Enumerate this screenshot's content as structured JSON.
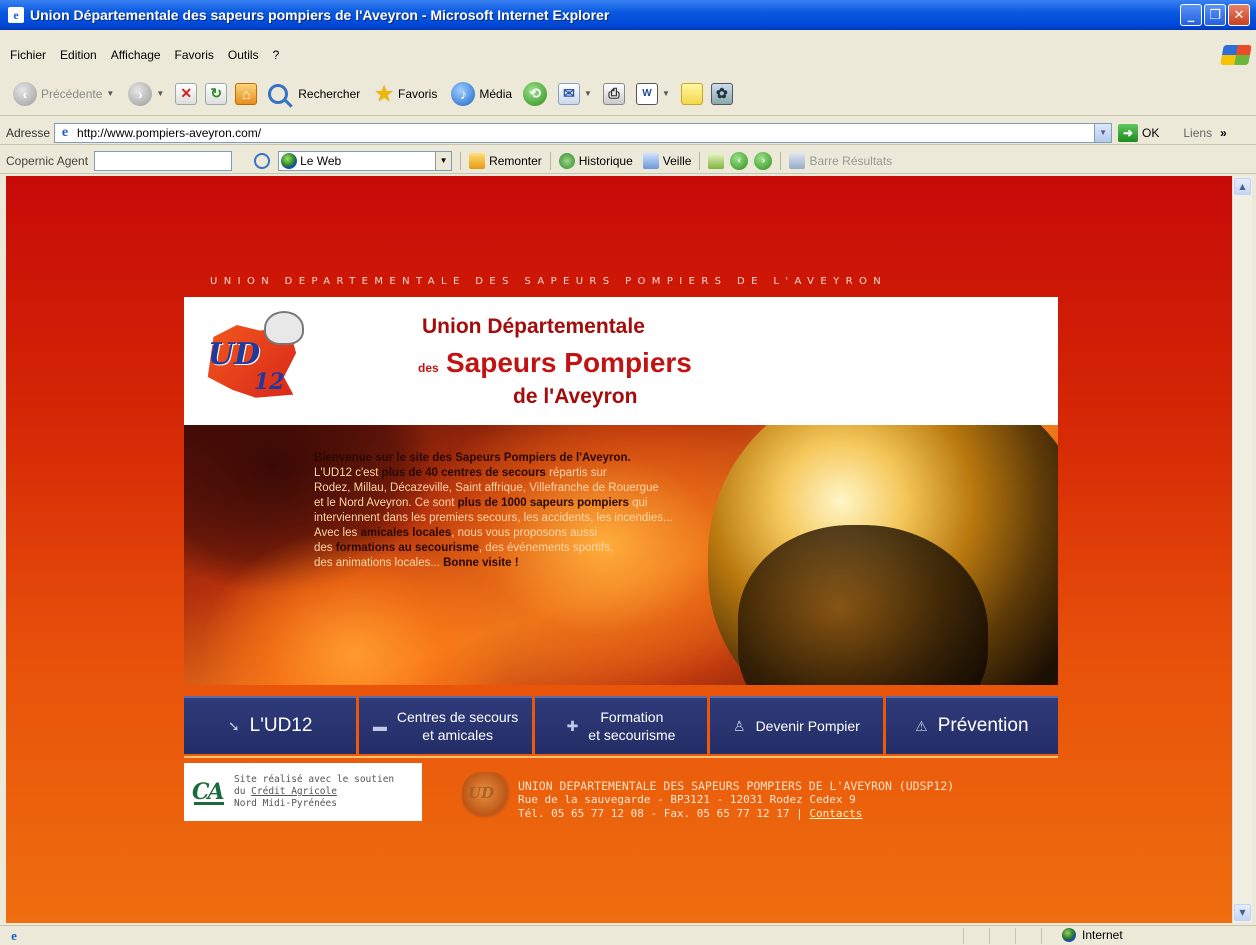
{
  "window": {
    "title": "Union Départementale des sapeurs pompiers de l'Aveyron - Microsoft Internet Explorer",
    "buttons": [
      "minimize",
      "maximize",
      "close"
    ]
  },
  "menu": [
    "Fichier",
    "Edition",
    "Affichage",
    "Favoris",
    "Outils",
    "?"
  ],
  "toolbar": {
    "back": "Précédente",
    "search": "Rechercher",
    "favorites": "Favoris",
    "media": "Média"
  },
  "address": {
    "label": "Adresse",
    "url": "http://www.pompiers-aveyron.com/",
    "go": "OK",
    "links": "Liens",
    "chevron": "»"
  },
  "copernic": {
    "label": "Copernic Agent",
    "scope": "Le Web",
    "remonter": "Remonter",
    "historique": "Historique",
    "veille": "Veille",
    "results": "Barre Résultats"
  },
  "page": {
    "union_title": "UNION DEPARTEMENTALE DES SAPEURS POMPIERS DE L'AVEYRON",
    "logo_ud": "UD",
    "logo_num": "12",
    "header": {
      "line1": "Union Départementale",
      "des": "des",
      "line2": "Sapeurs Pompiers",
      "line3": "de l'Aveyron"
    },
    "welcome": {
      "lead": "Bienvenue sur le site des Sapeurs Pompiers de l'Aveyron.",
      "p1a": "L'UD12 c'est ",
      "p1b": "plus de 40 centres de secours",
      "p1c": " répartis sur",
      "p2": "Rodez, Millau, Décazeville, Saint affrique, Villefranche de Rouergue",
      "p3a": "et le Nord Aveyron. Ce sont ",
      "p3b": "plus de 1000 sapeurs pompiers",
      "p3c": " qui",
      "p4": "interviennent dans les premiers secours, les accidents, les incendies...",
      "p5a": "Avec les ",
      "p5b": "amicales locales",
      "p5c": ", nous vous proposons aussi",
      "p6a": "des ",
      "p6b": "formations au secourisme",
      "p6c": ", des événements sportifs,",
      "p7a": "des animations locales...  ",
      "p7b": "Bonne visite !"
    },
    "nav": [
      {
        "label": "L'UD12",
        "icon": "arrow-icon"
      },
      {
        "label1": "Centres de secours",
        "label2": "et amicales",
        "icon": "truck-icon"
      },
      {
        "label1": "Formation",
        "label2": "et secourisme",
        "icon": "cross-icon"
      },
      {
        "label": "Devenir Pompier",
        "icon": "person-icon"
      },
      {
        "label": "Prévention",
        "icon": "warning-icon"
      }
    ],
    "credit": {
      "line1": "Site réalisé avec le soutien",
      "line2a": "du ",
      "line2b": "Crédit Agricole",
      "line3": "Nord Midi-Pyrénées"
    },
    "footer": {
      "logo": "UD",
      "line1": "UNION DEPARTEMENTALE DES SAPEURS POMPIERS DE L'AVEYRON (UDSP12)",
      "line2": "Rue de la sauvegarde - BP3121 - 12031 Rodez Cedex 9",
      "line3": "Tél. 05 65 77 12 08 - Fax. 05 65 77 12 17 | ",
      "contacts": "Contacts"
    }
  },
  "status": {
    "zone": "Internet"
  },
  "colors": {
    "xp_title": "#0a5ae0",
    "page_red": "#c70a07",
    "page_orange": "#ef6e0f",
    "nav_blue": "#2f3b7a",
    "header_red": "#c11412"
  }
}
